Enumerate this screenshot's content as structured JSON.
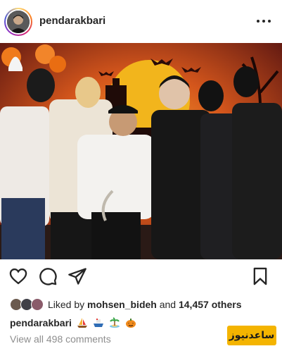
{
  "post": {
    "username": "pendarakbari",
    "avatar_icon": "profile-avatar",
    "more_icon": "more-options-icon"
  },
  "photo": {
    "icon": "halloween-party-photo",
    "colors": {
      "backdrop_orange": "#e8801f",
      "backdrop_red": "#b0271b",
      "moon": "#f2b51c"
    }
  },
  "actions": {
    "like_icon": "heart-icon",
    "comment_icon": "comment-icon",
    "share_icon": "send-icon",
    "save_icon": "bookmark-icon"
  },
  "likes": {
    "prefix": "Liked by",
    "user": "mohsen_bideh",
    "connector": "and",
    "count_text": "14,457 others"
  },
  "caption": {
    "username": "pendarakbari",
    "emojis": [
      "sailboat-emoji",
      "ship-emoji",
      "island-emoji",
      "pumpkin-emoji"
    ]
  },
  "comments": {
    "label": "View all 498 comments"
  },
  "watermark": {
    "text": "ساعدنیوز",
    "color": "#f4b400"
  }
}
